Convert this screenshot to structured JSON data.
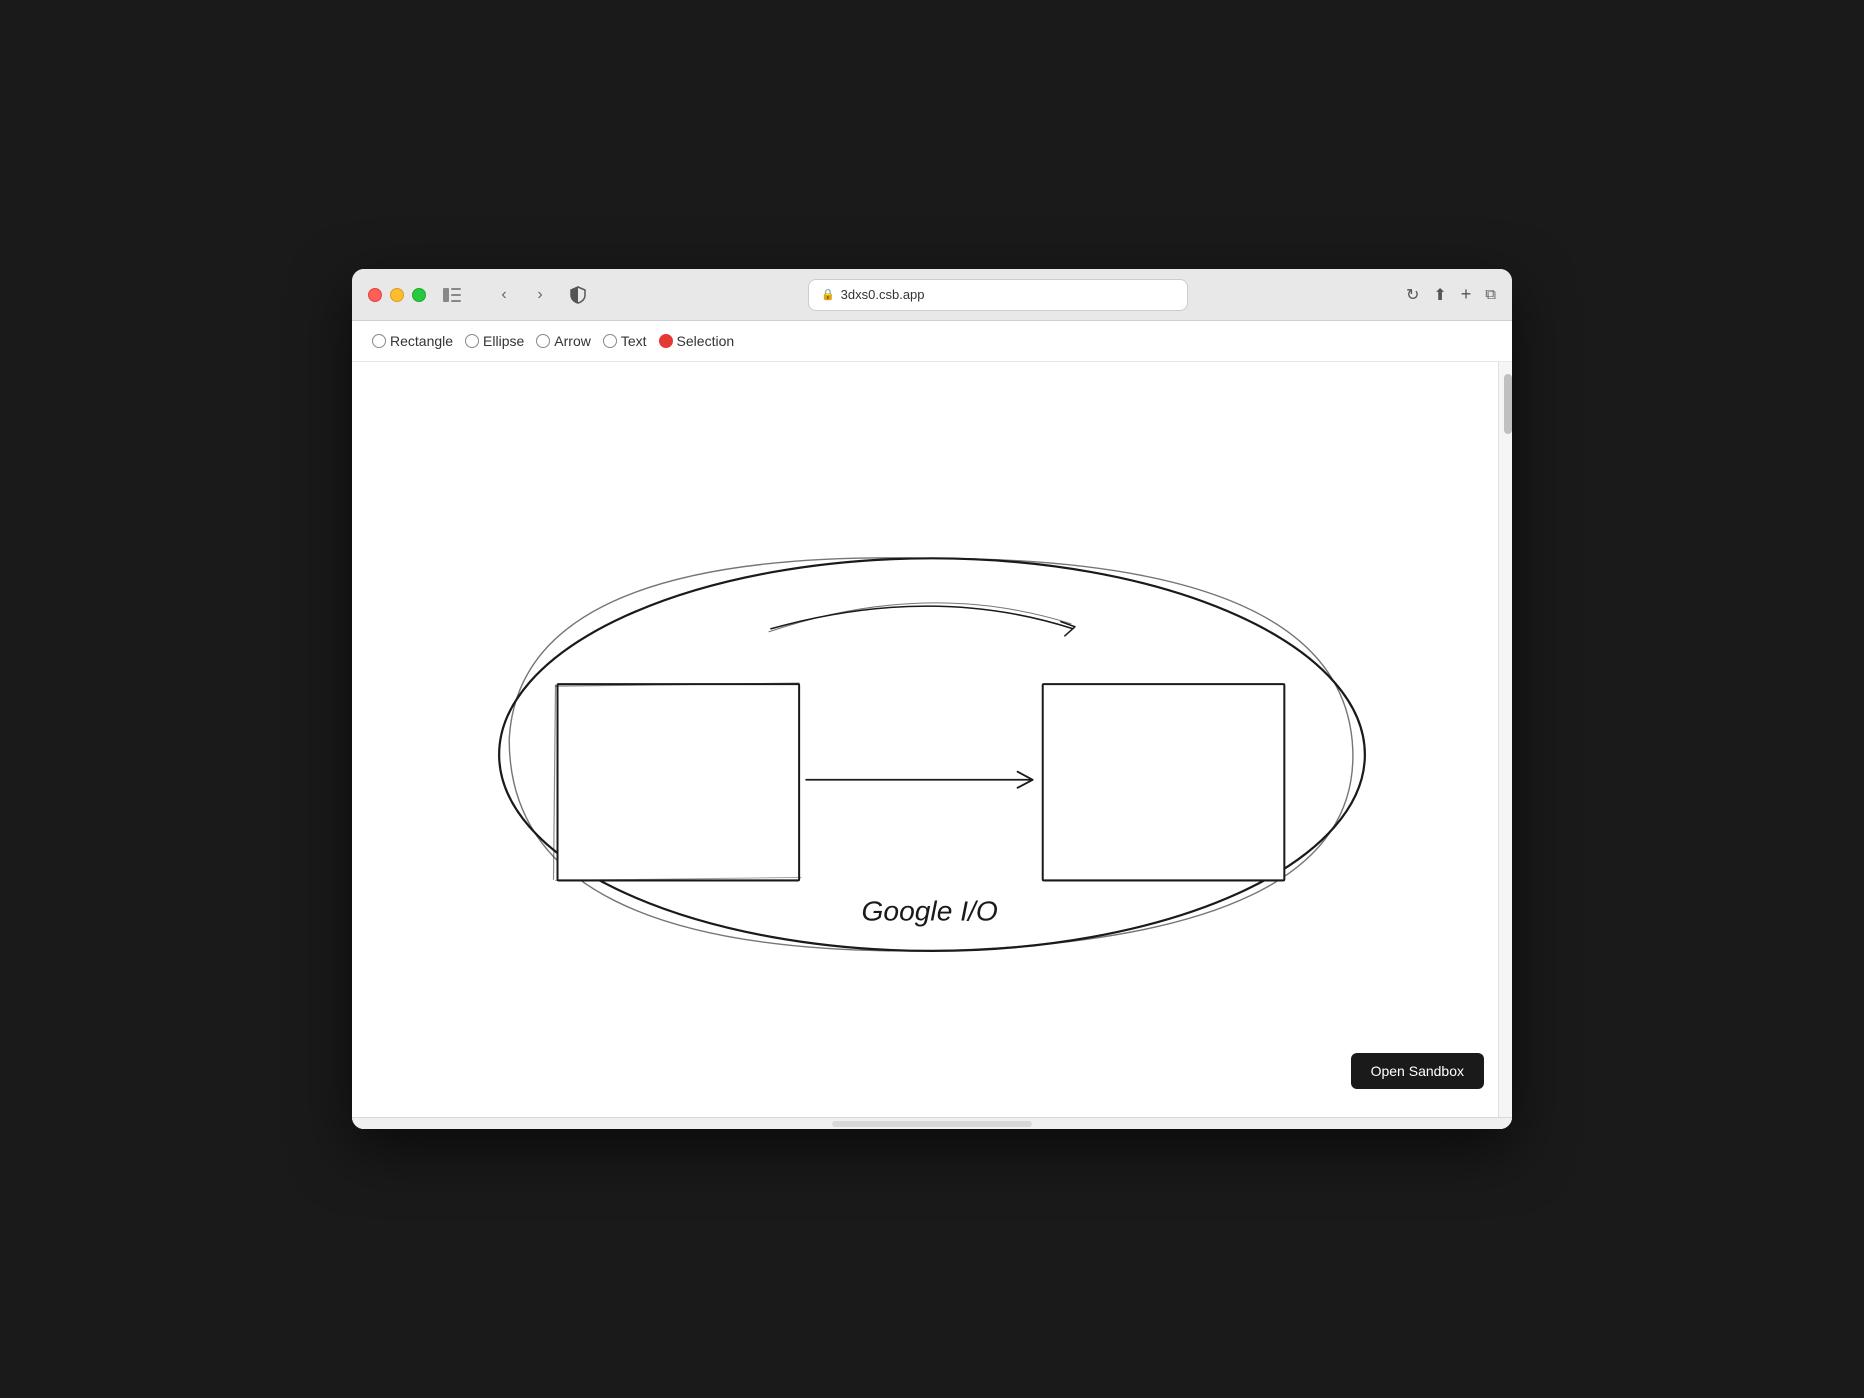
{
  "browser": {
    "url": "3dxs0.csb.app",
    "title": "3dxs0.csb.app"
  },
  "toolbar": {
    "tools": [
      {
        "id": "rectangle",
        "label": "Rectangle",
        "selected": false
      },
      {
        "id": "ellipse",
        "label": "Ellipse",
        "selected": false
      },
      {
        "id": "arrow",
        "label": "Arrow",
        "selected": false
      },
      {
        "id": "text",
        "label": "Text",
        "selected": false
      },
      {
        "id": "selection",
        "label": "Selection",
        "selected": true
      }
    ]
  },
  "canvas": {
    "diagram_text": "Google I/O"
  },
  "buttons": {
    "open_sandbox": "Open Sandbox"
  },
  "icons": {
    "back": "‹",
    "forward": "›",
    "reload": "↻",
    "share": "↑",
    "new_tab": "+",
    "tabs": "⧉",
    "lock": "🔒",
    "sidebar": "⊞",
    "shield": "⛨"
  }
}
